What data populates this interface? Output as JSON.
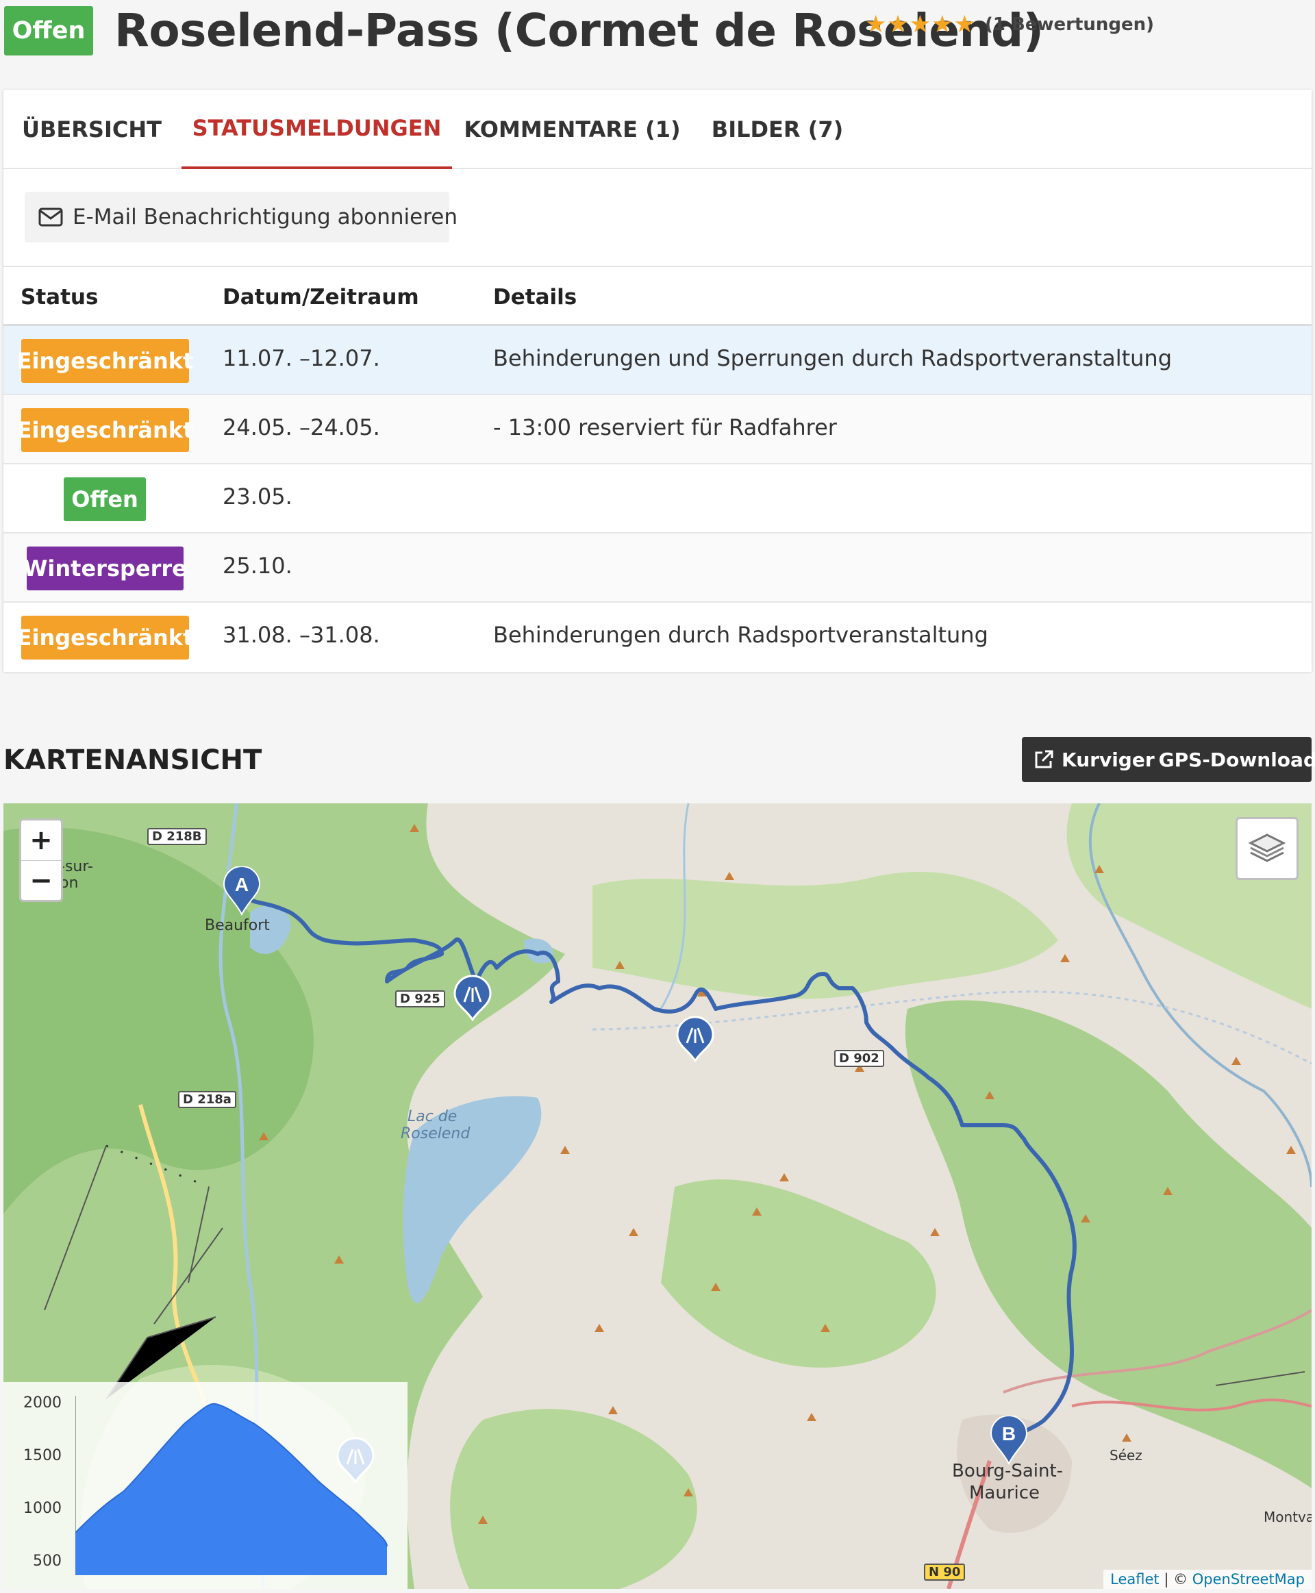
{
  "header": {
    "status_badge": "Offen",
    "title": "Roselend-Pass (Cormet de Roselend)",
    "rating_stars": 5,
    "rating_text": "(1 Bewertungen)"
  },
  "tabs": [
    {
      "label": "ÜBERSICHT",
      "active": false
    },
    {
      "label": "STATUSMELDUNGEN",
      "active": true
    },
    {
      "label": "KOMMENTARE (1)",
      "active": false
    },
    {
      "label": "BILDER (7)",
      "active": false
    }
  ],
  "subscribe": {
    "label": "E-Mail Benachrichtigung abonnieren",
    "icon": "envelope-icon"
  },
  "table": {
    "headers": {
      "status": "Status",
      "date": "Datum/Zeitraum",
      "details": "Details"
    },
    "rows": [
      {
        "status": "Eingeschränkt",
        "status_color": "#f4a12a",
        "date": "11.07. –12.07.",
        "details": "Behinderungen und Sperrungen durch Radsportveranstaltung",
        "highlight": true
      },
      {
        "status": "Eingeschränkt",
        "status_color": "#f4a12a",
        "date": "24.05. –24.05.",
        "details": "- 13:00 reserviert für Radfahrer",
        "highlight": false
      },
      {
        "status": "Offen",
        "status_color": "#4caf50",
        "date": "23.05.",
        "details": "",
        "highlight": false
      },
      {
        "status": "Wintersperre",
        "status_color": "#7b2fa0",
        "date": "25.10.",
        "details": "",
        "highlight": false
      },
      {
        "status": "Eingeschränkt",
        "status_color": "#f4a12a",
        "date": "31.08. –31.08.",
        "details": "Behinderungen durch Radsportveranstaltung",
        "highlight": false
      }
    ]
  },
  "map_section": {
    "title": "KARTENANSICHT",
    "kurviger_label": "Kurviger",
    "gps_label": "GPS-Download",
    "zoom_in": "+",
    "zoom_out": "−",
    "attribution_leaflet": "Leaflet",
    "attribution_sep": " | © ",
    "attribution_osm": "OpenStreetMap",
    "labels": {
      "beaufort": "Beaufort",
      "sur": "-sur-",
      "on": "on",
      "lac": "Lac de",
      "roselend": "Roselend",
      "bourg": "Bourg-Saint-",
      "maurice": "Maurice",
      "seez": "Séez",
      "montval": "Montval"
    },
    "road_tags": [
      "D 218B",
      "D 925",
      "D 218a",
      "D 902",
      "N 90"
    ],
    "markers": {
      "start": "A",
      "end": "B"
    },
    "elevation_ticks": [
      "2000",
      "1500",
      "1000",
      "500"
    ]
  },
  "colors": {
    "accent": "#c0312b",
    "open": "#4caf50",
    "restricted": "#f4a12a",
    "winter": "#7b2fa0",
    "route": "#3a66b0"
  }
}
